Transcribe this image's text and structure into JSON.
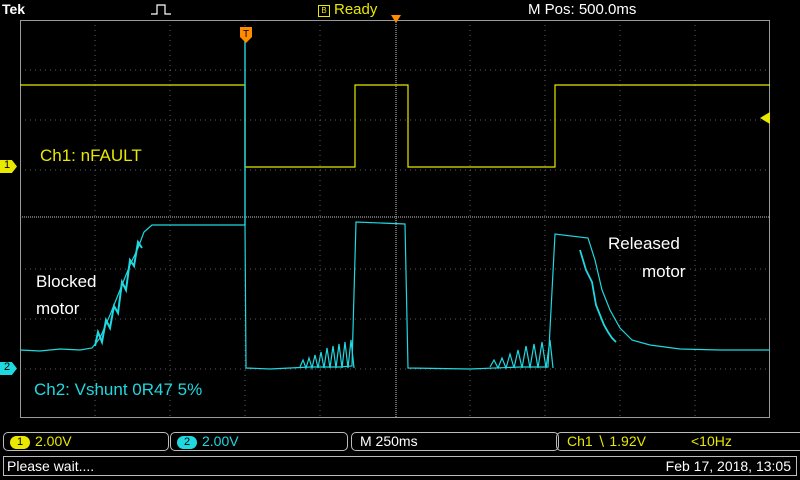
{
  "header": {
    "brand": "Tek",
    "status": "Ready",
    "mpos": "M Pos: 500.0ms"
  },
  "annotations": {
    "ch1_name": "Ch1: nFAULT",
    "blocked_line1": "Blocked",
    "blocked_line2": "motor",
    "released_line1": "Released",
    "released_line2": "motor",
    "ch2_name": "Ch2: Vshunt 0R47 5%"
  },
  "markers": {
    "ch1_marker": "1",
    "ch2_marker": "2",
    "trigger_marker": "T"
  },
  "infobar": {
    "ch1_badge": "1",
    "ch1_scale": "2.00V",
    "ch2_badge": "2",
    "ch2_scale": "2.00V",
    "timebase": "M 250ms",
    "trigger": "Ch1 ∖ 1.92V",
    "trigger_freq": "<10Hz"
  },
  "statusbar": {
    "message": "Please wait....",
    "datetime": "Feb 17, 2018, 13:05"
  },
  "colors": {
    "ch1": "#e8e800",
    "ch2": "#20d8e0",
    "trigger": "#ff8c00",
    "grid": "#6a6a6a"
  }
}
